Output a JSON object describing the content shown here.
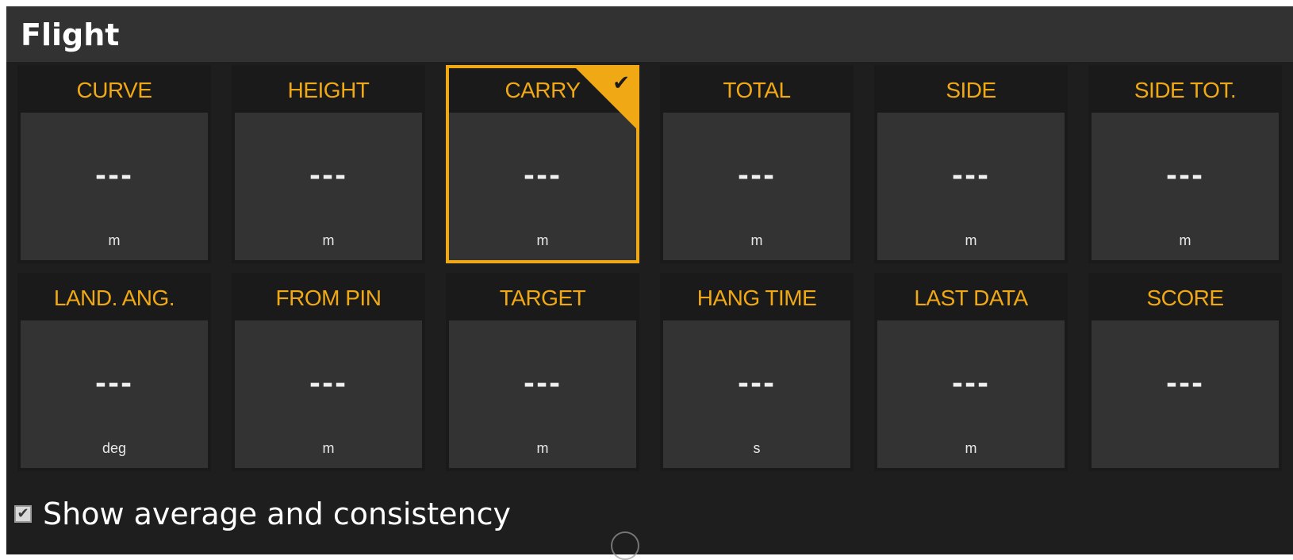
{
  "panel": {
    "title": "Flight"
  },
  "tiles": [
    {
      "label": "CURVE",
      "value": "---",
      "unit": "m",
      "selected": false
    },
    {
      "label": "HEIGHT",
      "value": "---",
      "unit": "m",
      "selected": false
    },
    {
      "label": "CARRY",
      "value": "---",
      "unit": "m",
      "selected": true
    },
    {
      "label": "TOTAL",
      "value": "---",
      "unit": "m",
      "selected": false
    },
    {
      "label": "SIDE",
      "value": "---",
      "unit": "m",
      "selected": false
    },
    {
      "label": "SIDE TOT.",
      "value": "---",
      "unit": "m",
      "selected": false
    },
    {
      "label": "LAND. ANG.",
      "value": "---",
      "unit": "deg",
      "selected": false
    },
    {
      "label": "FROM PIN",
      "value": "---",
      "unit": "m",
      "selected": false
    },
    {
      "label": "TARGET",
      "value": "---",
      "unit": "m",
      "selected": false
    },
    {
      "label": "HANG TIME",
      "value": "---",
      "unit": "s",
      "selected": false
    },
    {
      "label": "LAST DATA",
      "value": "---",
      "unit": "m",
      "selected": false
    },
    {
      "label": "SCORE",
      "value": "---",
      "unit": "",
      "selected": false
    }
  ],
  "footer": {
    "checkbox_label": "Show average and consistency",
    "checked": true
  },
  "colors": {
    "accent": "#f0a814",
    "panel_bg": "#1e1e1e",
    "title_bar": "#323232",
    "tile_body": "#333333",
    "tile_header": "#1a1a1a"
  },
  "icons": {
    "selected_tile": "check-icon",
    "checkbox": "checkbox-checked-icon"
  }
}
